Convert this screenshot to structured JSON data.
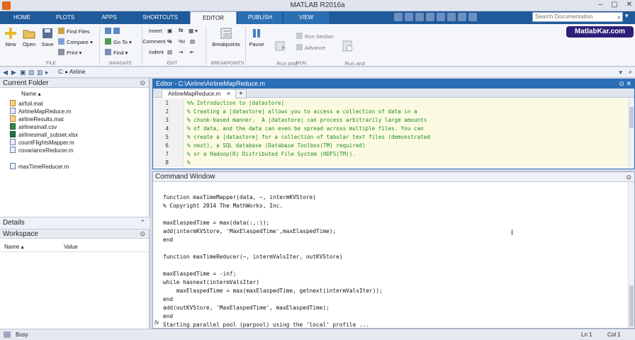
{
  "window": {
    "title": "MATLAB R2016a",
    "min": "–",
    "max": "▢",
    "close": "✕"
  },
  "tabs": [
    "HOME",
    "PLOTS",
    "APPS",
    "SHORTCUTS",
    "EDITOR",
    "PUBLISH",
    "VIEW"
  ],
  "active_tab": "EDITOR",
  "search": {
    "placeholder": "Search Documentation"
  },
  "ribbon": {
    "file": {
      "new": "New",
      "open": "Open",
      "save": "Save",
      "find_files": "Find Files",
      "compare": "Compare",
      "print": "Print",
      "label": "FILE"
    },
    "navigate": {
      "goto": "Go To",
      "find": "Find",
      "label": "NAVIGATE"
    },
    "edit": {
      "insert": "Insert",
      "fx": "fx",
      "comment": "Comment",
      "indent": "Indent",
      "label": "EDIT"
    },
    "breakpoints": {
      "breakpoints": "Breakpoints",
      "label": "BREAKPOINTS"
    },
    "run": {
      "pause": "Pause",
      "run_advance": "Run and\nAdvance",
      "run_section": "Run Section",
      "advance": "Advance",
      "run_time": "Run and\nTime",
      "label": "RUN"
    }
  },
  "badge": "MatlabKar.com",
  "address": {
    "drive": "C:",
    "folder": "Airline"
  },
  "current_folder": {
    "title": "Current Folder",
    "column": "Name",
    "files": [
      {
        "name": "airfoil.mat",
        "type": "mat"
      },
      {
        "name": "AirlineMapReduce.m",
        "type": "m"
      },
      {
        "name": "airlineResults.mat",
        "type": "mat"
      },
      {
        "name": "airlinesmall.csv",
        "type": "csv"
      },
      {
        "name": "airlinesmall_subset.xlsx",
        "type": "xls"
      },
      {
        "name": "countFlightsMapper.m",
        "type": "m"
      },
      {
        "name": "covarianceReducer.m",
        "type": "m"
      },
      {
        "name": "maxTimeReducer.m",
        "type": "m"
      }
    ]
  },
  "details": {
    "title": "Details"
  },
  "workspace": {
    "title": "Workspace",
    "col_name": "Name",
    "col_value": "Value"
  },
  "editor": {
    "title": "Editor - C:\\Airline\\AirlineMapReduce.m",
    "tab": "AirlineMapReduce.m",
    "plus": "+",
    "lines": [
      {
        "n": "1",
        "text": "%% Introduction to |datastore|"
      },
      {
        "n": "2",
        "text": "% Creating a |datastore| allows you to access a collection of data in a"
      },
      {
        "n": "3",
        "text": "% chunk-based manner.  A |datastore| can process arbitrarily large amounts"
      },
      {
        "n": "4",
        "text": "% of data, and the data can even be spread across multiple files. You can"
      },
      {
        "n": "5",
        "text": "% create a |datastore| for a collection of tabular text files (demonstrated"
      },
      {
        "n": "6",
        "text": "% next), a SQL database (Database Toolbox(TM) required)"
      },
      {
        "n": "7",
        "text": "% or a Hadoop(R) Distributed File System (HDFS(TM))."
      },
      {
        "n": "8",
        "text": "%"
      }
    ]
  },
  "command_window": {
    "title": "Command Window",
    "lines": [
      "function maxTimeMapper(data, ~, intermKVStore)",
      "% Copyright 2014 The MathWorks, Inc.",
      "",
      "maxElaspedTime = max(data(:,:));",
      "add(intermKVStore, 'MaxElaspedTime',maxElaspedTime);",
      "end",
      "",
      "function maxTimeReducer(~, intermValsIter, outKVStore)",
      "",
      "maxElaspedTime = -inf;",
      "while hasnext(intermValsIter)",
      "    maxElaspedTime = max(maxElaspedTime, getnext(intermValsIter));",
      "end",
      "add(outKVStore, 'MaxElaspedTime', maxElaspedTime);",
      "end",
      "Starting parallel pool (parpool) using the 'local' profile ..."
    ],
    "prompt": "fx"
  },
  "status": {
    "text": "Busy",
    "ln": "Ln  1",
    "col": "Col  1"
  }
}
